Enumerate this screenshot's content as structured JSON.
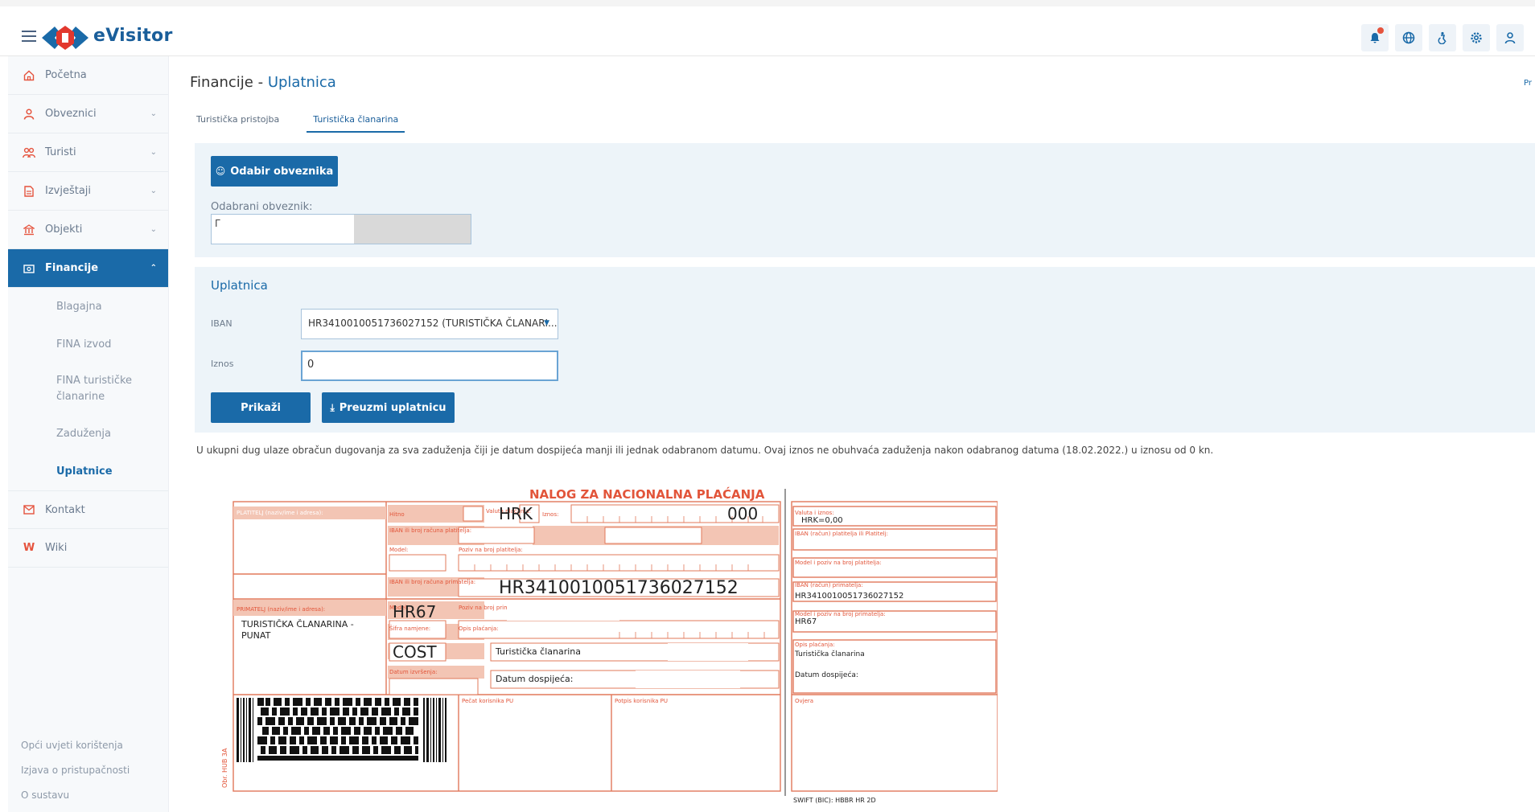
{
  "app": {
    "brand": "eVisitor",
    "brand_color": "#1a5e9a",
    "accent": "#1a6aa8",
    "slip_color": "#e2785a"
  },
  "topbar": {
    "icons": [
      "bell-icon",
      "globe-icon",
      "accessibility-icon",
      "gear-icon",
      "user-icon"
    ]
  },
  "sidebar": {
    "items": [
      {
        "label": "Početna",
        "icon": "home-icon"
      },
      {
        "label": "Obveznici",
        "icon": "person-icon"
      },
      {
        "label": "Turisti",
        "icon": "people-icon"
      },
      {
        "label": "Izvještaji",
        "icon": "report-icon"
      },
      {
        "label": "Objekti",
        "icon": "building-icon"
      },
      {
        "label": "Financije",
        "icon": "finance-icon"
      }
    ],
    "sub_items": [
      "Blagajna",
      "FINA izvod",
      "FINA turističke",
      "članarine",
      "Zaduženja",
      "Uplatnice"
    ],
    "after": [
      {
        "label": "Kontakt",
        "icon": "mail-icon"
      },
      {
        "label": "Wiki",
        "icon": "wiki-icon"
      }
    ],
    "footer": [
      "Opći uvjeti korištenja",
      "Izjava o pristupačnosti",
      "O sustavu"
    ]
  },
  "page": {
    "title_prefix": "Financije - ",
    "title_accent": "Uplatnica",
    "right_edge": "Pr",
    "tabs": [
      "Turistička pristojba",
      "Turistička članarina"
    ]
  },
  "panel1": {
    "button": "Odabir obveznika",
    "label": "Odabrani obveznik:",
    "value": "Г"
  },
  "panel2": {
    "title": "Uplatnica",
    "iban_label": "IBAN",
    "iban_value": "HR3410010051736027152 (TURISTIČKA ČLANARI...",
    "amount_label": "Iznos",
    "amount_value": "0",
    "show_button": "Prikaži",
    "download_button": "Preuzmi uplatnicu"
  },
  "notice": "U ukupni dug ulaze obračun dugovanja za sva zaduženja čiji je datum dospijeća manji ili jednak odabranom datumu. Ovaj iznos ne obuhvaća zaduženja nakon odabranog datuma (18.02.2022.) u iznosu od 0 kn.",
  "slip": {
    "title": "NALOG ZA NACIONALNA PLAĆANJA",
    "platitelj_label": "PLATITELJ (naziv/ime i adresa):",
    "hitno": "Hitno",
    "valuta_label": "Valuta plaćanja:",
    "currency": "HRK",
    "iznos_label": "Iznos:",
    "amount_digits": "000",
    "iban_platitelj_label": "IBAN ili broj računa platitelja:",
    "model_label": "Model:",
    "poziv_platitelj_label": "Poziv na broj platitelja:",
    "iban_primatelj_label": "IBAN ili broj računa primatelja:",
    "iban_primatelj": "HR3410010051736027152",
    "primatelj_label": "PRIMATELJ (naziv/ime i adresa):",
    "primatelj_line1": "TURISTIČKA ČLANARINA -",
    "primatelj_line2": "PUNAT",
    "model_value": "HR67",
    "poziv_primatelj_label": "Poziv na broj primatelja:",
    "sifra_label": "Šifra namjene:",
    "sifra_value": "COST",
    "opis_label": "Opis plaćanja:",
    "opis_value": "Turistička članarina",
    "datum_izvrsenja_label": "Datum izvršenja:",
    "datum_dospijeca": "Datum dospijeća:",
    "pecat_label": "Pečat korisnika PU",
    "potpis_label": "Potpis korisnika PU",
    "side_note": "Obr. HUB 3A",
    "right_valuta_label": "Valuta i iznos:",
    "right_amount": "HRK=0,00",
    "right_iban_platitelj": "IBAN (račun) platitelja ili Platitelj:",
    "right_model_platitelj": "Model i poziv na broj platitelja:",
    "right_iban_primatelj_label": "IBAN (račun) primatelja:",
    "right_iban_primatelj": "HR3410010051736027152",
    "right_model_primatelj": "Model i poziv na broj primatelja:",
    "right_model_value": "HR67",
    "right_opis_label": "Opis plaćanja:",
    "right_opis": "Turistička članarina",
    "right_datum": "Datum dospijeća:",
    "ovjera": "Ovjera",
    "swift": "SWIFT (BIC): HBBR HR 2D"
  }
}
